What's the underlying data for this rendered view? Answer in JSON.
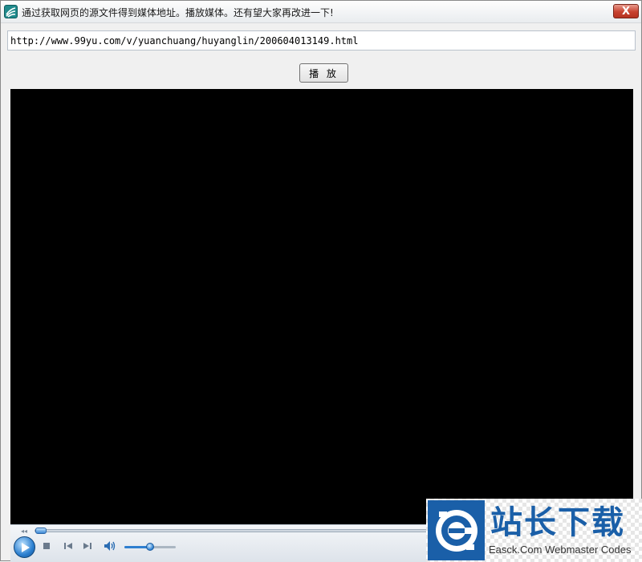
{
  "window": {
    "title": "通过获取网页的源文件得到媒体地址。播放媒体。还有望大家再改进一下!",
    "close_label": "X"
  },
  "url_field": {
    "value": "http://www.99yu.com/v/yuanchuang/huyanglin/200604013149.html"
  },
  "play_button": {
    "label": "播 放"
  },
  "player": {
    "seek_icon": "◂◂",
    "seek_progress": 0.0,
    "volume_level": 0.5,
    "icons": {
      "play": "play-icon",
      "stop": "stop-icon",
      "previous": "previous-icon",
      "next": "next-icon",
      "volume": "speaker-icon"
    }
  },
  "watermark": {
    "title": "站长下载",
    "subtitle": "Easck.Com Webmaster Codes"
  },
  "colors": {
    "accent": "#1a5fa8",
    "video_background": "#000000",
    "close_button": "#c7412f"
  }
}
